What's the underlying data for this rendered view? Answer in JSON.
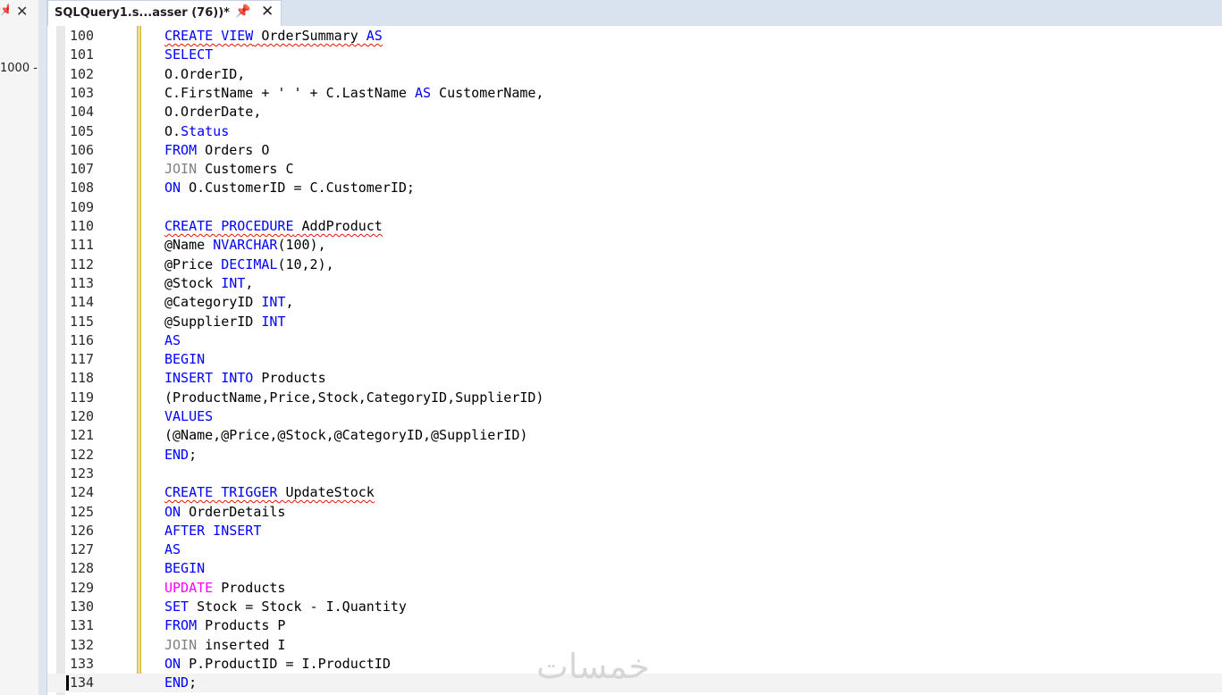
{
  "left_panel": {
    "text": "1000 -",
    "close_glyph": "✕",
    "pin_glyph": "📌"
  },
  "tab": {
    "title": "SQLQuery1.s...asser (76))*",
    "pin_glyph": "📌",
    "close_glyph": "✕",
    "pin_icon": "pin-icon",
    "close_icon": "close-icon"
  },
  "watermark": "خمسات",
  "editor": {
    "current_line": "134",
    "lines": [
      {
        "n": "100",
        "t": [
          [
            "CREATE VIEW",
            "kw sq"
          ],
          [
            " OrderSummary ",
            "plain sq"
          ],
          [
            "AS",
            "kw sq"
          ]
        ]
      },
      {
        "n": "101",
        "t": [
          [
            "SELECT",
            "kw"
          ]
        ]
      },
      {
        "n": "102",
        "t": [
          [
            "O.OrderID,",
            "plain"
          ]
        ]
      },
      {
        "n": "103",
        "t": [
          [
            "C.FirstName + ' ' + C.LastName ",
            "plain"
          ],
          [
            "AS",
            "kw"
          ],
          [
            " CustomerName,",
            "plain"
          ]
        ]
      },
      {
        "n": "104",
        "t": [
          [
            "O.OrderDate,",
            "plain"
          ]
        ]
      },
      {
        "n": "105",
        "t": [
          [
            "O.",
            "plain"
          ],
          [
            "Status",
            "kw"
          ]
        ]
      },
      {
        "n": "106",
        "t": [
          [
            "FROM",
            "kw"
          ],
          [
            " Orders O",
            "plain"
          ]
        ]
      },
      {
        "n": "107",
        "t": [
          [
            "JOIN",
            "gr"
          ],
          [
            " Customers C",
            "plain"
          ]
        ]
      },
      {
        "n": "108",
        "t": [
          [
            "ON",
            "kw"
          ],
          [
            " O.CustomerID = C.CustomerID;",
            "plain"
          ]
        ]
      },
      {
        "n": "109",
        "t": []
      },
      {
        "n": "110",
        "t": [
          [
            "CREATE PROCEDURE",
            "kw sq"
          ],
          [
            " AddProduct",
            "plain sq"
          ]
        ]
      },
      {
        "n": "111",
        "t": [
          [
            "@Name ",
            "plain"
          ],
          [
            "NVARCHAR",
            "kw"
          ],
          [
            "(100),",
            "plain"
          ]
        ]
      },
      {
        "n": "112",
        "t": [
          [
            "@Price ",
            "plain"
          ],
          [
            "DECIMAL",
            "kw"
          ],
          [
            "(10,2),",
            "plain"
          ]
        ]
      },
      {
        "n": "113",
        "t": [
          [
            "@Stock ",
            "plain"
          ],
          [
            "INT",
            "kw"
          ],
          [
            ",",
            "plain"
          ]
        ]
      },
      {
        "n": "114",
        "t": [
          [
            "@CategoryID ",
            "plain"
          ],
          [
            "INT",
            "kw"
          ],
          [
            ",",
            "plain"
          ]
        ]
      },
      {
        "n": "115",
        "t": [
          [
            "@SupplierID ",
            "plain"
          ],
          [
            "INT",
            "kw"
          ]
        ]
      },
      {
        "n": "116",
        "t": [
          [
            "AS",
            "kw"
          ]
        ]
      },
      {
        "n": "117",
        "t": [
          [
            "BEGIN",
            "kw"
          ]
        ]
      },
      {
        "n": "118",
        "t": [
          [
            "INSERT INTO",
            "kw"
          ],
          [
            " Products",
            "plain"
          ]
        ]
      },
      {
        "n": "119",
        "t": [
          [
            "(ProductName,Price,Stock,CategoryID,SupplierID)",
            "plain"
          ]
        ]
      },
      {
        "n": "120",
        "t": [
          [
            "VALUES",
            "kw"
          ]
        ]
      },
      {
        "n": "121",
        "t": [
          [
            "(@Name,@Price,@Stock,@CategoryID,@SupplierID)",
            "plain"
          ]
        ]
      },
      {
        "n": "122",
        "t": [
          [
            "END",
            "kw"
          ],
          [
            ";",
            "plain"
          ]
        ]
      },
      {
        "n": "123",
        "t": []
      },
      {
        "n": "124",
        "t": [
          [
            "CREATE TRIGGER",
            "kw sq"
          ],
          [
            " UpdateStock",
            "plain sq"
          ]
        ]
      },
      {
        "n": "125",
        "t": [
          [
            "ON",
            "kw"
          ],
          [
            " OrderDetails",
            "plain"
          ]
        ]
      },
      {
        "n": "126",
        "t": [
          [
            "AFTER INSERT",
            "kw"
          ]
        ]
      },
      {
        "n": "127",
        "t": [
          [
            "AS",
            "kw"
          ]
        ]
      },
      {
        "n": "128",
        "t": [
          [
            "BEGIN",
            "kw"
          ]
        ]
      },
      {
        "n": "129",
        "t": [
          [
            "UPDATE",
            "fn"
          ],
          [
            " Products",
            "plain"
          ]
        ]
      },
      {
        "n": "130",
        "t": [
          [
            "SET",
            "kw"
          ],
          [
            " Stock = Stock - I.Quantity",
            "plain"
          ]
        ]
      },
      {
        "n": "131",
        "t": [
          [
            "FROM",
            "kw"
          ],
          [
            " Products P",
            "plain"
          ]
        ]
      },
      {
        "n": "132",
        "t": [
          [
            "JOIN",
            "gr"
          ],
          [
            " inserted I",
            "plain"
          ]
        ]
      },
      {
        "n": "133",
        "t": [
          [
            "ON",
            "kw"
          ],
          [
            " P.ProductID = I.ProductID",
            "plain"
          ]
        ]
      },
      {
        "n": "134",
        "t": [
          [
            "END",
            "kw"
          ],
          [
            ";",
            "plain"
          ]
        ]
      }
    ]
  }
}
